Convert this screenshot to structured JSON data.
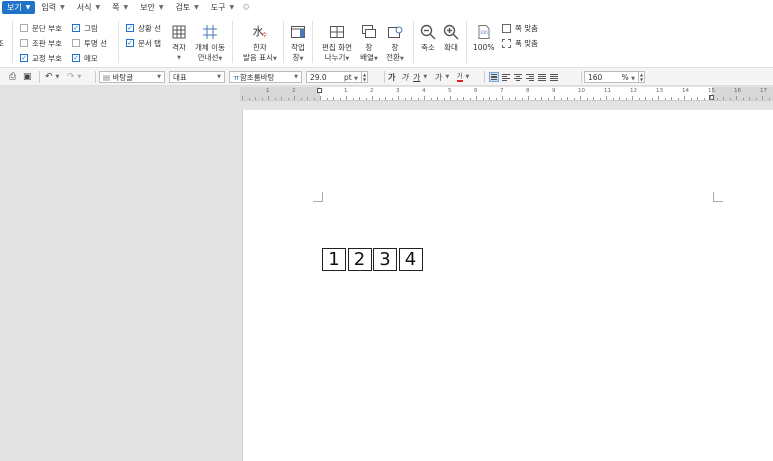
{
  "menubar": {
    "items": [
      {
        "label": "보기",
        "active": true
      },
      {
        "label": "입력"
      },
      {
        "label": "서식"
      },
      {
        "label": "쪽"
      },
      {
        "label": "보안"
      },
      {
        "label": "검토"
      },
      {
        "label": "도구"
      }
    ]
  },
  "ribbon": {
    "left_cut_label": "조",
    "checkboxes": [
      {
        "label": "문단 부호",
        "checked": false
      },
      {
        "label": "조판 부호",
        "checked": false
      },
      {
        "label": "교정 부호",
        "checked": true
      },
      {
        "label": "그림",
        "checked": true
      },
      {
        "label": "투명 선",
        "checked": false
      },
      {
        "label": "메모",
        "checked": true
      },
      {
        "label": "상황 선",
        "checked": true
      },
      {
        "label": "문서 탭",
        "checked": true
      }
    ],
    "grid": {
      "label": "격자"
    },
    "object_guide": {
      "line1": "개체 이동",
      "line2": "안내선"
    },
    "hanja": {
      "line1": "한자",
      "line2": "발음 표시"
    },
    "task_pane": {
      "line1": "작업",
      "line2": "창"
    },
    "split_screen": {
      "line1": "편집 화면",
      "line2": "나누기"
    },
    "window_arrange": {
      "line1": "창",
      "line2": "배열"
    },
    "window_switch": {
      "line1": "창",
      "line2": "전환"
    },
    "zoom_out": {
      "label": "축소"
    },
    "zoom_in": {
      "label": "확대"
    },
    "zoom_100": {
      "label": "100%"
    },
    "fit_width": {
      "label": "쪽 맞춤"
    },
    "fit_page": {
      "label": "폭 맞춤"
    }
  },
  "toolbar": {
    "style": "바탕글",
    "language": "대표",
    "font": "함초롬바탕",
    "font_size": "29.0",
    "font_unit": "pt",
    "zoom": "160",
    "zoom_unit": "%"
  },
  "ruler": {
    "numbers": [
      "1",
      "2",
      "1",
      "2",
      "3",
      "4",
      "5",
      "6",
      "7",
      "8",
      "9",
      "10",
      "11",
      "12",
      "13",
      "14",
      "15",
      "16",
      "17"
    ]
  },
  "document": {
    "cells": [
      "1",
      "2",
      "3",
      "4"
    ]
  }
}
